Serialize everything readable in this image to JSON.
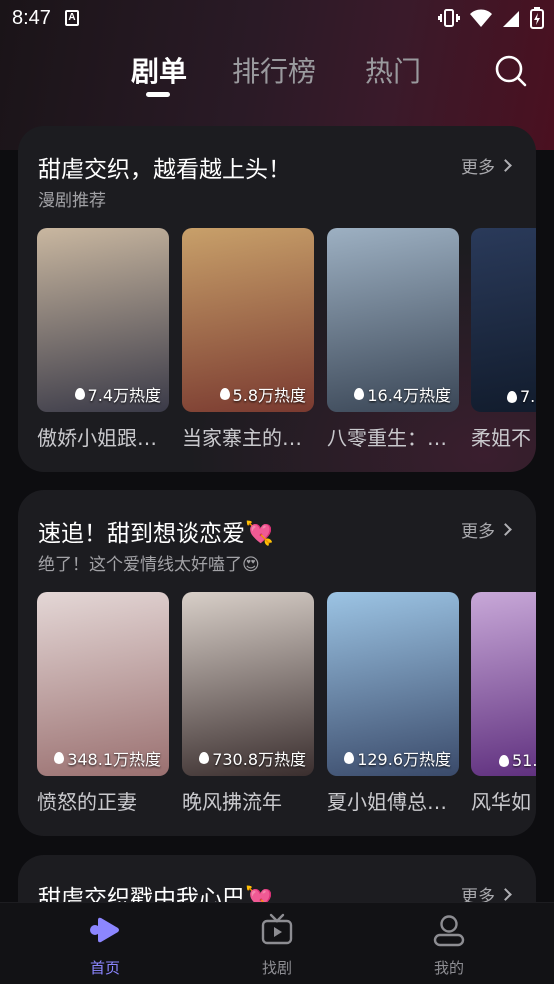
{
  "status": {
    "time": "8:47"
  },
  "topnav": {
    "tabs": [
      "剧单",
      "排行榜",
      "热门"
    ],
    "active": "剧单"
  },
  "sections": [
    {
      "title": "甜虐交织，越看越上头！",
      "subtitle": "漫剧推荐",
      "more": "更多",
      "items": [
        {
          "title": "傲娇小姐跟…",
          "heat": "7.4万热度",
          "poster_colors": [
            "#c9b7a0",
            "#3a3a48"
          ]
        },
        {
          "title": "当家寨主的…",
          "heat": "5.8万热度",
          "poster_colors": [
            "#c8a06a",
            "#7a3a30"
          ]
        },
        {
          "title": "八零重生：…",
          "heat": "16.4万热度",
          "poster_colors": [
            "#9db0c2",
            "#3a4656"
          ]
        },
        {
          "title": "柔姐不",
          "heat": "7.",
          "poster_colors": [
            "#2a3a5a",
            "#101a2a"
          ]
        }
      ]
    },
    {
      "title": "速追！甜到想谈恋爱💘",
      "subtitle": "绝了！这个爱情线太好嗑了😍",
      "more": "更多",
      "items": [
        {
          "title": "愤怒的正妻",
          "heat": "348.1万热度",
          "poster_colors": [
            "#e4d7d6",
            "#9a7070"
          ]
        },
        {
          "title": "晚风拂流年",
          "heat": "730.8万热度",
          "poster_colors": [
            "#d8cfc8",
            "#3a2e2e"
          ]
        },
        {
          "title": "夏小姐傅总…",
          "heat": "129.6万热度",
          "poster_colors": [
            "#9cc4e4",
            "#3a4a6a"
          ]
        },
        {
          "title": "风华如",
          "heat": "51.",
          "poster_colors": [
            "#c8a8d8",
            "#5a2a7a"
          ]
        }
      ]
    },
    {
      "title": "甜虐交织戳中我心巴💘",
      "more": "更多"
    }
  ],
  "bottomnav": [
    {
      "label": "首页",
      "icon": "play-home-icon",
      "active": true
    },
    {
      "label": "找剧",
      "icon": "tv-icon",
      "active": false
    },
    {
      "label": "我的",
      "icon": "user-icon",
      "active": false
    }
  ],
  "colors": {
    "accent": "#8c86ff",
    "background": "#0d0d10",
    "card": "#1c1c20"
  }
}
